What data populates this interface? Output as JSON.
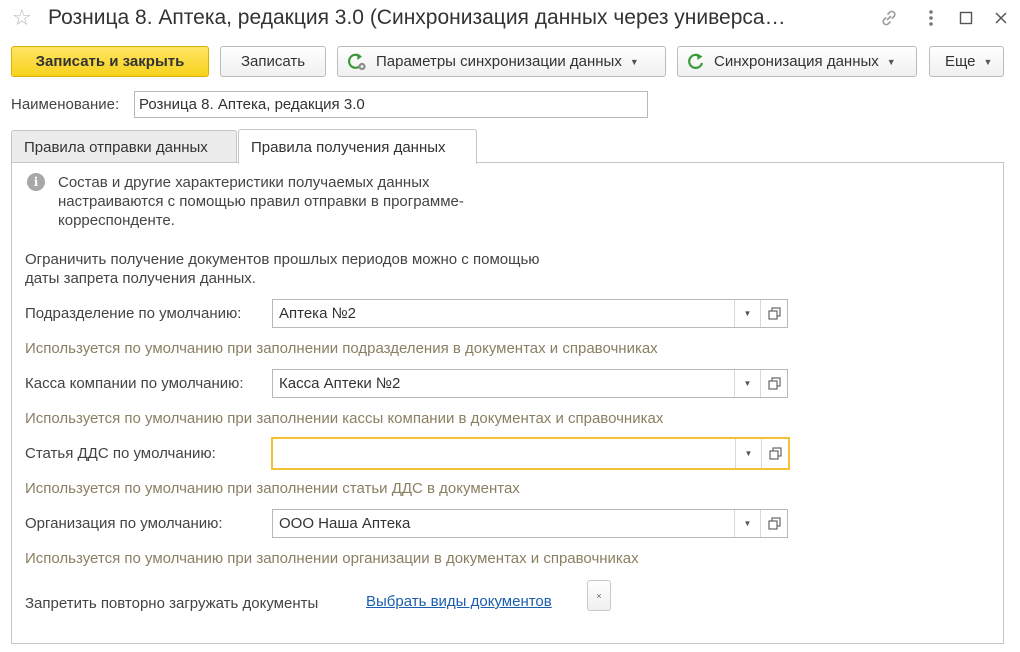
{
  "window": {
    "title": "Розница 8. Аптека, редакция 3.0 (Синхронизация данных через универса…"
  },
  "toolbar": {
    "save_close_label": "Записать и закрыть",
    "save_label": "Записать",
    "sync_params_label": "Параметры синхронизации данных",
    "sync_label": "Синхронизация данных",
    "more_label": "Еще"
  },
  "name_field": {
    "label": "Наименование:",
    "value": "Розница 8. Аптека, редакция 3.0"
  },
  "tabs": [
    {
      "label": "Правила отправки данных",
      "active": false
    },
    {
      "label": "Правила получения данных",
      "active": true
    }
  ],
  "panel": {
    "info_text": "Состав и другие характеристики получаемых данных настраиваются с помощью правил отправки в программе-корреспонденте.",
    "note_text": "Ограничить получение документов прошлых периодов можно с помощью даты запрета получения данных.",
    "fields": [
      {
        "label": "Подразделение по умолчанию:",
        "value": "Аптека №2",
        "hint": "Используется по умолчанию при заполнении подразделения в документах и  справочниках"
      },
      {
        "label": "Касса компании по умолчанию:",
        "value": "Касса Аптеки №2",
        "hint": "Используется по умолчанию при заполнении кассы компании в документах и  справочниках"
      },
      {
        "label": "Статья ДДС по умолчанию:",
        "value": "",
        "hint": "Используется по умолчанию при заполнении статьи ДДС в документах"
      },
      {
        "label": "Организация по умолчанию:",
        "value": "ООО Наша Аптека",
        "hint": "Используется по умолчанию при заполнении организации в документах и  справочниках"
      }
    ],
    "forbid_label": "Запретить повторно загружать документы",
    "choose_docs_link": "Выбрать виды документов"
  },
  "colors": {
    "primary_button": "#f7d21b",
    "hint_text": "#8a7f63",
    "link": "#1b5fae",
    "focus_border": "#f1c232",
    "sync_icon": "#3a9a3a"
  },
  "icons": {
    "favorite": "star-icon",
    "link": "link-icon",
    "more": "kebab-icon",
    "maximize": "maximize-icon",
    "close": "close-icon",
    "sync_params": "sync-gear-icon",
    "sync": "sync-icon",
    "info": "info-icon",
    "open": "open-form-icon"
  }
}
